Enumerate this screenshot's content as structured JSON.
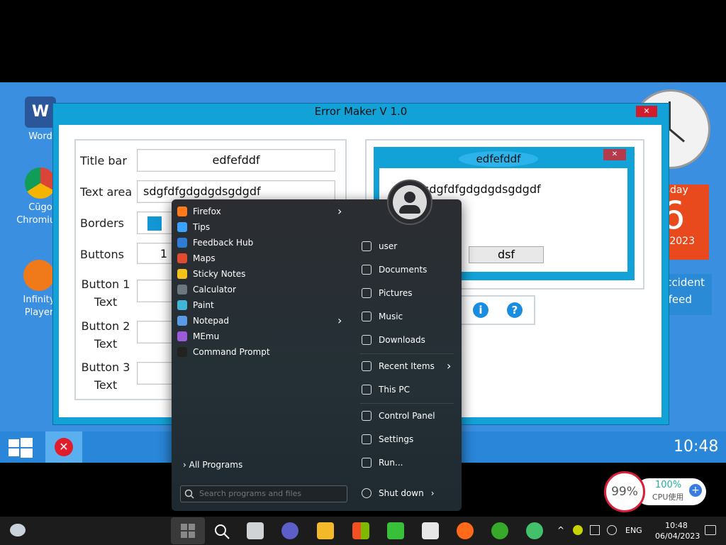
{
  "desktop": {
    "icons": [
      {
        "label": "Word",
        "icon": "word-icon"
      },
      {
        "label": "Cūgo Chromium",
        "icon": "chromium-icon"
      },
      {
        "label": "Infinity Player",
        "icon": "player-icon"
      }
    ],
    "clock_widget": {
      "icon": "analog-clock-icon"
    },
    "calendar_widget": {
      "day_name": "rsday",
      "day_number": "6",
      "year": "2023"
    },
    "news_widget": {
      "line1": "accident",
      "line2": "s feed"
    }
  },
  "error_maker": {
    "title": "Error Maker V 1.0",
    "close_label": "✕",
    "fields": {
      "title_bar_label": "Title bar",
      "title_bar_value": "edfefddf",
      "text_area_label": "Text area",
      "text_area_value": "sdgfdfgdgdgdsgdgdf",
      "borders_label": "Borders",
      "buttons_label": "Buttons",
      "buttons_value": "1",
      "button1_label_a": "Button 1",
      "button1_label_b": "Text",
      "button2_label_a": "Button 2",
      "button2_label_b": "Text",
      "button3_label_a": "Button 3",
      "button3_label_b": "Text"
    },
    "preview": {
      "title": "edfefddf",
      "close_label": "✕",
      "message": "sdgfdfgdgdgdsgdgdf",
      "button_label": "dsf"
    },
    "icon_row": [
      "info-icon",
      "question-icon"
    ]
  },
  "vm_taskbar": {
    "time": "10:48"
  },
  "start_menu": {
    "programs": [
      {
        "label": "Firefox",
        "icon": "firefox-icon",
        "color": "#ff7a1a",
        "submenu": true
      },
      {
        "label": "Tips",
        "icon": "tips-icon",
        "color": "#3aa3ff",
        "submenu": false
      },
      {
        "label": "Feedback Hub",
        "icon": "feedback-hub-icon",
        "color": "#2f7bd8",
        "submenu": false
      },
      {
        "label": "Maps",
        "icon": "maps-icon",
        "color": "#e04b32",
        "submenu": false
      },
      {
        "label": "Sticky Notes",
        "icon": "sticky-notes-icon",
        "color": "#f2c31a",
        "submenu": false
      },
      {
        "label": "Calculator",
        "icon": "calculator-icon",
        "color": "#6d7780",
        "submenu": false
      },
      {
        "label": "Paint",
        "icon": "paint-icon",
        "color": "#42b4d8",
        "submenu": false
      },
      {
        "label": "Notepad",
        "icon": "notepad-icon",
        "color": "#5a9be6",
        "submenu": true
      },
      {
        "label": "MEmu",
        "icon": "memu-icon",
        "color": "#9b5ad8",
        "submenu": false
      },
      {
        "label": "Command Prompt",
        "icon": "command-prompt-icon",
        "color": "#222222",
        "submenu": false
      }
    ],
    "all_programs": "All Programs",
    "search_placeholder": "Search programs and files",
    "right_items": [
      {
        "label": "user",
        "icon": "user-folder-icon"
      },
      {
        "label": "Documents",
        "icon": "documents-icon"
      },
      {
        "label": "Pictures",
        "icon": "pictures-icon"
      },
      {
        "label": "Music",
        "icon": "music-icon"
      },
      {
        "label": "Downloads",
        "icon": "downloads-icon"
      },
      {
        "label": "Recent Items",
        "icon": "recent-items-icon",
        "submenu": true
      },
      {
        "label": "This PC",
        "icon": "this-pc-icon"
      },
      {
        "label": "Control Panel",
        "icon": "control-panel-icon"
      },
      {
        "label": "Settings",
        "icon": "settings-icon"
      },
      {
        "label": "Run...",
        "icon": "run-icon"
      }
    ],
    "shutdown": "Shut down"
  },
  "cpu_widget": {
    "gauge": "99%",
    "percent": "100%",
    "label": "CPU使用"
  },
  "host_taskbar": {
    "language": "ENG",
    "time": "10:48",
    "date": "06/04/2023"
  }
}
